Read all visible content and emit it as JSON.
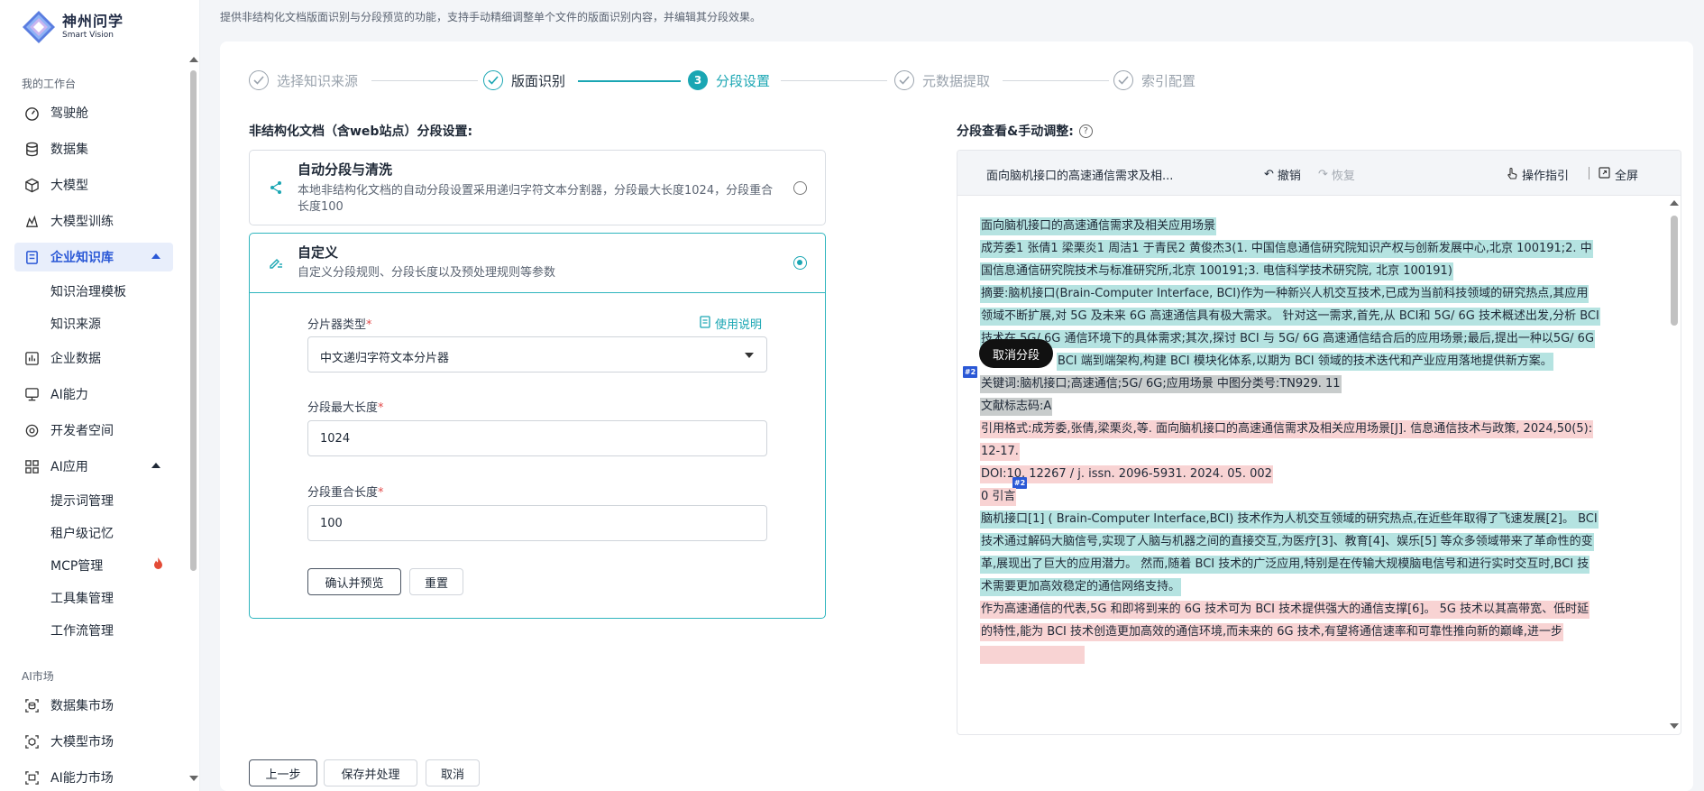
{
  "brand": {
    "title": "神州问学",
    "subtitle": "Smart Vision"
  },
  "sidebar": {
    "sections": [
      "我的工作台",
      "AI市场"
    ],
    "items": [
      {
        "label": "驾驶舱",
        "icon": "speedometer-icon"
      },
      {
        "label": "数据集",
        "icon": "database-icon"
      },
      {
        "label": "大模型",
        "icon": "cube-icon"
      },
      {
        "label": "大模型训练",
        "icon": "training-icon"
      },
      {
        "label": "企业知识库",
        "icon": "knowledge-base-icon",
        "active": true
      },
      {
        "label": "企业数据",
        "icon": "bar-chart-icon"
      },
      {
        "label": "AI能力",
        "icon": "monitor-icon"
      },
      {
        "label": "开发者空间",
        "icon": "developer-icon"
      },
      {
        "label": "AI应用",
        "icon": "apps-grid-icon"
      },
      {
        "label": "数据集市场",
        "icon": "dataset-market-icon"
      },
      {
        "label": "大模型市场",
        "icon": "model-market-icon"
      },
      {
        "label": "AI能力市场",
        "icon": "ability-market-icon"
      }
    ],
    "kb_subitems": [
      "知识治理模板",
      "知识来源"
    ],
    "app_subitems": [
      "提示词管理",
      "租户级记忆",
      "MCP管理",
      "工具集管理",
      "工作流管理"
    ]
  },
  "top_note": "提供非结构化文档版面识别与分段预览的功能，支持手动精细调整单个文件的版面识别内容，并编辑其分段效果。",
  "steps": [
    {
      "label": "选择知识来源",
      "state": "done"
    },
    {
      "label": "版面识别",
      "state": "done"
    },
    {
      "label": "分段设置",
      "state": "current",
      "number": "3"
    },
    {
      "label": "元数据提取",
      "state": "pending"
    },
    {
      "label": "索引配置",
      "state": "pending"
    }
  ],
  "left": {
    "section_title": "非结构化文档（含web站点）分段设置:",
    "auto": {
      "title": "自动分段与清洗",
      "desc": "本地非结构化文档的自动分段设置采用递归字符文本分割器，分段最大长度1024，分段重合长度100",
      "selected": false
    },
    "custom": {
      "title": "自定义",
      "desc": "自定义分段规则、分段长度以及预处理规则等参数",
      "selected": true
    },
    "help_link": "使用说明",
    "fields": {
      "splitter_label": "分片器类型",
      "splitter_value": "中文递归字符文本分片器",
      "maxlen_label": "分段最大长度",
      "maxlen_value": "1024",
      "overlap_label": "分段重合长度",
      "overlap_value": "100",
      "required_mark": "*"
    },
    "confirm_button": "确认并预览",
    "reset_button": "重置"
  },
  "right": {
    "section_title": "分段查看&手动调整:",
    "doc_title": "面向脑机接口的高速通信需求及相...",
    "undo": "撤销",
    "redo": "恢复",
    "guide": "操作指引",
    "fullscreen": "全屏",
    "popup": "取消分段",
    "segment_tag": "#2",
    "lines": [
      {
        "text": "面向脑机接口的高速通信需求及相关应用场景",
        "hl": "teal"
      },
      {
        "text": "成芳委1 张倩1 梁栗炎1 周洁1 于青民2 黄俊杰3(1. 中国信息通信研究院知识产权与创新发展中心,北京 100191;2. 中",
        "hl": "teal"
      },
      {
        "text": "国信息通信研究院技术与标准研究所,北京 100191;3. 电信科学技术研究院, 北京 100191)",
        "hl": "teal"
      },
      {
        "text": "摘要:脑机接口(Brain-Computer Interface, BCI)作为一种新兴人机交互技术,已成为当前科技领域的研究热点,其应用",
        "hl": "teal"
      },
      {
        "text": "领域不断扩展,对 5G 及未来 6G 高速通信具有极大需求。 针对这一需求,首先,从 BCI和 5G/ 6G 技术概述出发,分析 BCI",
        "hl": "teal"
      },
      {
        "text": "技术在 5G/ 6G 通信环境下的具体需求;其次,探讨 BCI 与 5G/ 6G 高速通信结合后的应用场景;最后,提出一种以5G/ 6G",
        "hl": "teal"
      },
      {
        "text": "BCI 端到端架构,构建 BCI 模块化体系,以期为 BCI 领域的技术迭代和产业应用落地提供新方案。",
        "hl": "teal"
      },
      {
        "text": "关键词:脑机接口;高速通信;5G/ 6G;应用场景 中图分类号:TN929. 11",
        "hl": "grey"
      },
      {
        "text": "文献标志码:A",
        "hl": "grey"
      },
      {
        "text": "引用格式:成芳委,张倩,梁栗炎,等. 面向脑机接口的高速通信需求及相关应用场景[J]. 信息通信技术与政策, 2024,50(5):",
        "hl": "pink"
      },
      {
        "text": "12-17.",
        "hl": "pink"
      },
      {
        "text": "DOI:10. 12267 / j. issn. 2096-5931. 2024. 05. 002",
        "hl": "pink"
      },
      {
        "text": "0 引言",
        "hl": "pink"
      },
      {
        "text": "脑机接口[1] ( Brain-Computer Interface,BCI) 技术作为人机交互领域的研究热点,在近些年取得了飞速发展[2]。 BCI",
        "hl": "teal"
      },
      {
        "text": "技术通过解码大脑信号,实现了人脑与机器之间的直接交互,为医疗[3]、教育[4]、娱乐[5] 等众多领域带来了革命性的变",
        "hl": "teal"
      },
      {
        "text": "革,展现出了巨大的应用潜力。 然而,随着 BCI 技术的广泛应用,特别是在传输大规模脑电信号和进行实时交互时,BCI 技",
        "hl": "teal"
      },
      {
        "text": "术需要更加高效稳定的通信网络支持。",
        "hl": "teal"
      },
      {
        "text": "作为高速通信的代表,5G 和即将到来的 6G 技术可为 BCI 技术提供强大的通信支撑[6]。 5G 技术以其高带宽、低时延",
        "hl": "pink"
      },
      {
        "text": "的特性,能为 BCI 技术创造更加高效的通信环境,而未来的 6G 技术,有望将通信速率和可靠性推向新的巅峰,进一步",
        "hl": "pink"
      }
    ]
  },
  "bottom": {
    "prev": "上一步",
    "save": "保存并处理",
    "cancel": "取消"
  },
  "colors": {
    "accent": "#1aa6b3",
    "primary": "#2a58d6",
    "teal_hl": "#b5e3e1",
    "pink_hl": "#f8d3d3",
    "grey_hl": "#c8cccc"
  }
}
